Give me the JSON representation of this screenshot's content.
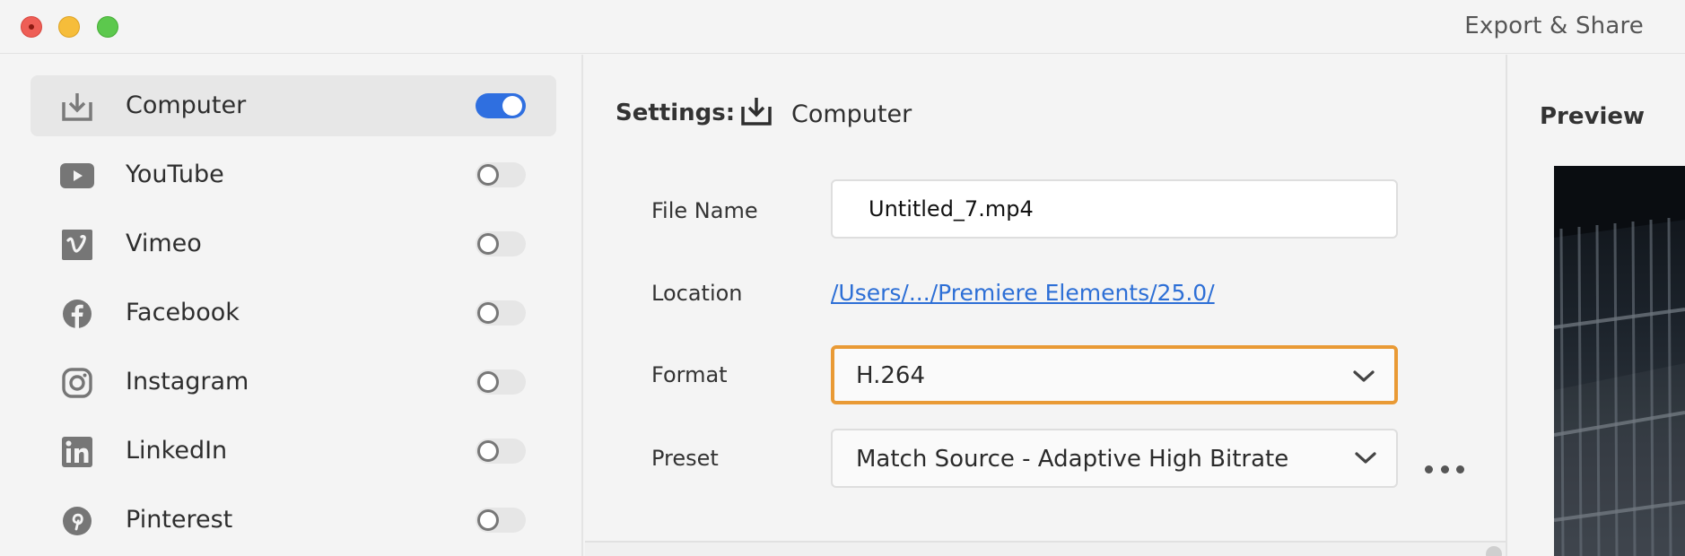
{
  "window": {
    "title": "Export & Share"
  },
  "colors": {
    "accent": "#2f6fe0",
    "focus_ring": "#e99a35",
    "link": "#2d6fd6"
  },
  "sidebar": {
    "items": [
      {
        "label": "Computer",
        "icon": "download-tray-icon",
        "enabled": true,
        "selected": true
      },
      {
        "label": "YouTube",
        "icon": "youtube-icon",
        "enabled": false,
        "selected": false
      },
      {
        "label": "Vimeo",
        "icon": "vimeo-icon",
        "enabled": false,
        "selected": false
      },
      {
        "label": "Facebook",
        "icon": "facebook-icon",
        "enabled": false,
        "selected": false
      },
      {
        "label": "Instagram",
        "icon": "instagram-icon",
        "enabled": false,
        "selected": false
      },
      {
        "label": "LinkedIn",
        "icon": "linkedin-icon",
        "enabled": false,
        "selected": false
      },
      {
        "label": "Pinterest",
        "icon": "pinterest-icon",
        "enabled": false,
        "selected": false
      }
    ]
  },
  "settings": {
    "header": "Settings:",
    "destination": "Computer",
    "file_name": {
      "label": "File Name",
      "value": "Untitled_7.mp4"
    },
    "location": {
      "label": "Location",
      "value": "/Users/.../Premiere Elements/25.0/"
    },
    "format": {
      "label": "Format",
      "value": "H.264"
    },
    "preset": {
      "label": "Preset",
      "value": "Match Source - Adaptive High Bitrate"
    }
  },
  "preview": {
    "title": "Preview"
  }
}
